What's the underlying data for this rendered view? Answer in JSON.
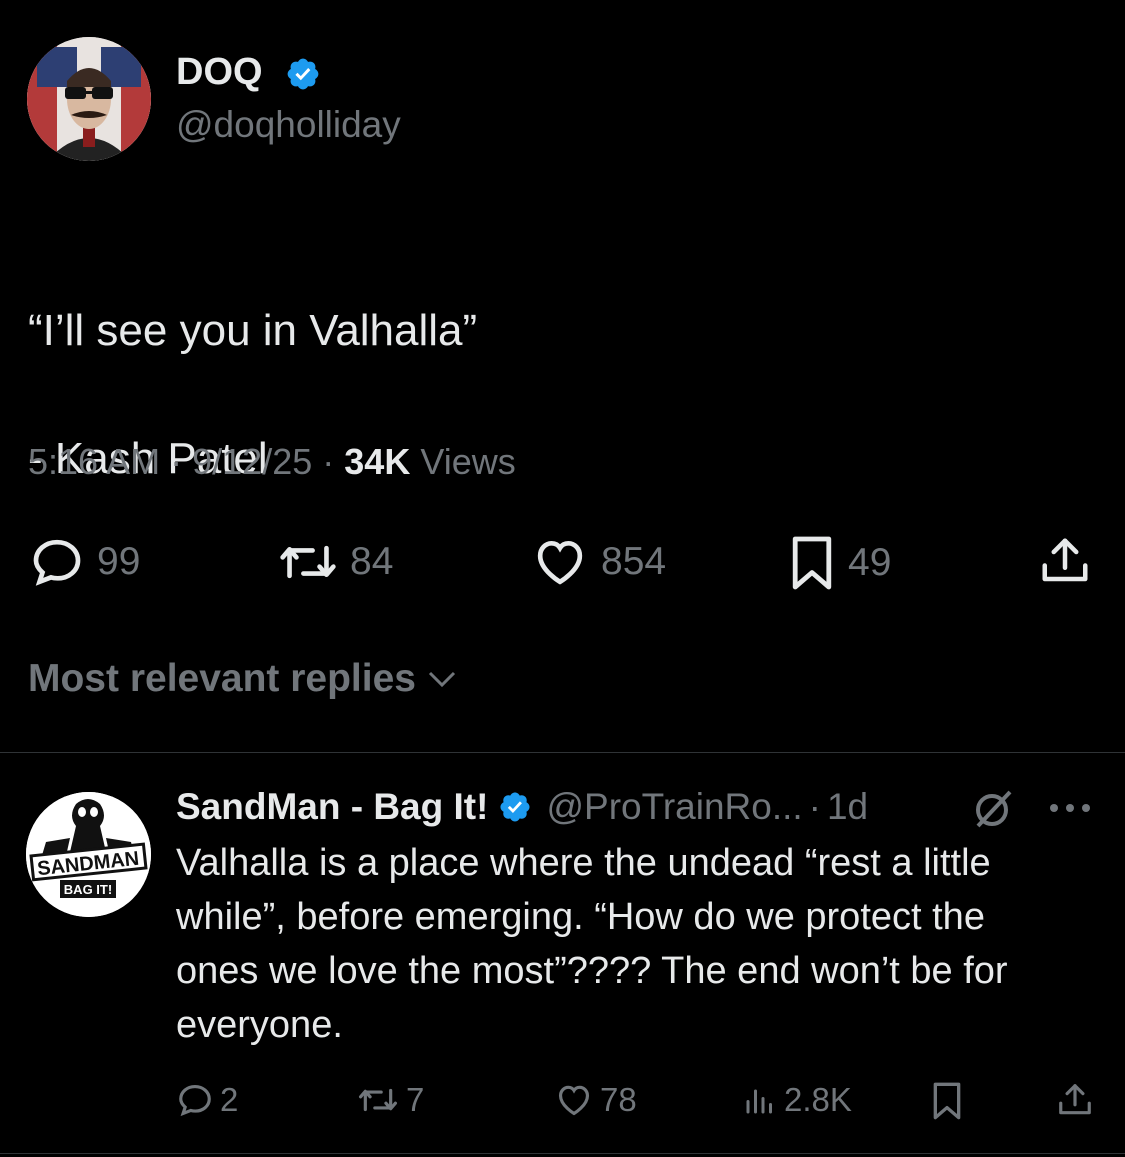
{
  "main_tweet": {
    "display_name": "DOQ",
    "handle": "@doqholliday",
    "text_line1": "“I’ll see you in Valhalla”",
    "text_line2": "- Kash Patel",
    "time": "5:16 AM",
    "date": "9/12/25",
    "views_count": "34K",
    "views_label": "Views",
    "sep": "·",
    "replies": "99",
    "reposts": "84",
    "likes": "854",
    "bookmarks": "49"
  },
  "replies_sort": {
    "label": "Most relevant replies"
  },
  "reply": {
    "display_name": "SandMan - Bag It!",
    "handle": "@ProTrainRo...",
    "time": "1d",
    "sep": "·",
    "text": "Valhalla is a place where the undead “rest a little while”, before emerging. “How do we protect the ones we love the most”???? The end won’t be for everyone.",
    "replies": "2",
    "reposts": "7",
    "likes": "78",
    "views": "2.8K",
    "avatar_logo_text": "SANDMAN",
    "avatar_logo_sub": "BAG IT!"
  },
  "colors": {
    "background": "#000000",
    "text_primary": "#e7e9ea",
    "text_secondary": "#71767b",
    "verified_blue": "#1d9bf0",
    "divider": "#2f3336"
  },
  "icons": [
    "verified-badge-icon",
    "reply-icon",
    "repost-icon",
    "like-icon",
    "bookmark-icon",
    "share-icon",
    "chevron-down-icon",
    "grok-icon",
    "more-icon",
    "views-icon"
  ]
}
